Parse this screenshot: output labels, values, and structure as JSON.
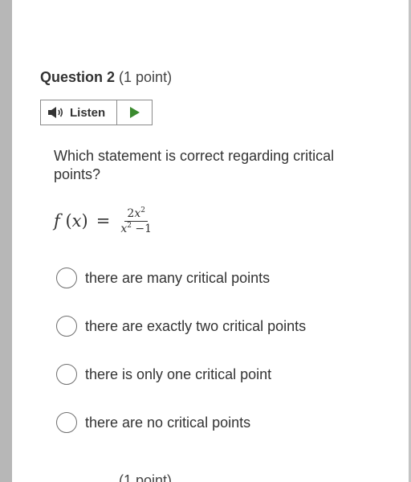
{
  "question": {
    "title": "Question 2",
    "points": "(1 point)"
  },
  "listen_widget": {
    "listen_label": "Listen",
    "speaker_icon": "speaker-icon",
    "play_icon": "play-icon",
    "play_color": "#3a8a2e"
  },
  "prompt": "Which statement is correct regarding critical points?",
  "formula": {
    "lhs": "f (x)",
    "eq": "=",
    "numerator": "2x²",
    "denominator": "x² −1"
  },
  "options": [
    {
      "label": "there are many critical points",
      "selected": false
    },
    {
      "label": "there are exactly two critical points",
      "selected": false
    },
    {
      "label": "there is only one critical point",
      "selected": false
    },
    {
      "label": "there are no critical points",
      "selected": false
    }
  ],
  "next_question": {
    "points": "(1 point)"
  }
}
